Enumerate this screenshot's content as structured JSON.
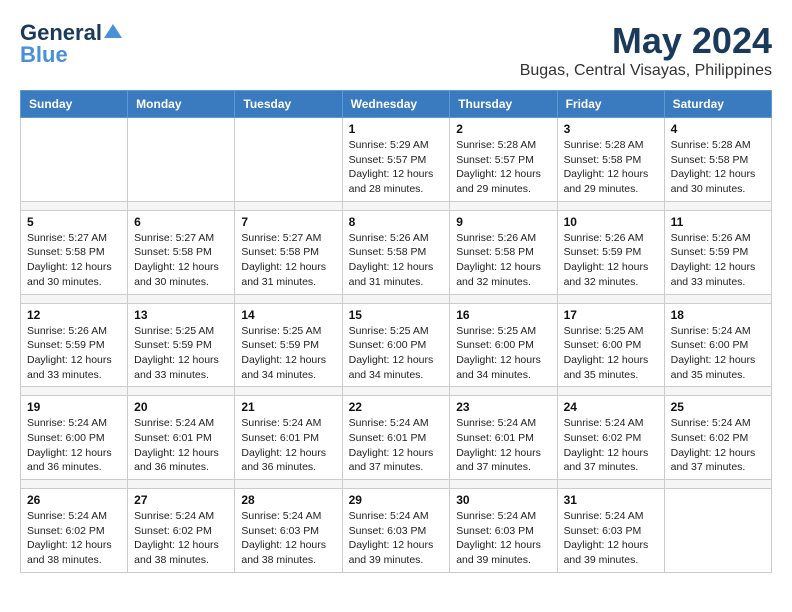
{
  "header": {
    "logo_line1": "General",
    "logo_line2": "Blue",
    "month_year": "May 2024",
    "location": "Bugas, Central Visayas, Philippines"
  },
  "weekdays": [
    "Sunday",
    "Monday",
    "Tuesday",
    "Wednesday",
    "Thursday",
    "Friday",
    "Saturday"
  ],
  "weeks": [
    [
      {
        "day": "",
        "info": ""
      },
      {
        "day": "",
        "info": ""
      },
      {
        "day": "",
        "info": ""
      },
      {
        "day": "1",
        "info": "Sunrise: 5:29 AM\nSunset: 5:57 PM\nDaylight: 12 hours\nand 28 minutes."
      },
      {
        "day": "2",
        "info": "Sunrise: 5:28 AM\nSunset: 5:57 PM\nDaylight: 12 hours\nand 29 minutes."
      },
      {
        "day": "3",
        "info": "Sunrise: 5:28 AM\nSunset: 5:58 PM\nDaylight: 12 hours\nand 29 minutes."
      },
      {
        "day": "4",
        "info": "Sunrise: 5:28 AM\nSunset: 5:58 PM\nDaylight: 12 hours\nand 30 minutes."
      }
    ],
    [
      {
        "day": "5",
        "info": "Sunrise: 5:27 AM\nSunset: 5:58 PM\nDaylight: 12 hours\nand 30 minutes."
      },
      {
        "day": "6",
        "info": "Sunrise: 5:27 AM\nSunset: 5:58 PM\nDaylight: 12 hours\nand 30 minutes."
      },
      {
        "day": "7",
        "info": "Sunrise: 5:27 AM\nSunset: 5:58 PM\nDaylight: 12 hours\nand 31 minutes."
      },
      {
        "day": "8",
        "info": "Sunrise: 5:26 AM\nSunset: 5:58 PM\nDaylight: 12 hours\nand 31 minutes."
      },
      {
        "day": "9",
        "info": "Sunrise: 5:26 AM\nSunset: 5:58 PM\nDaylight: 12 hours\nand 32 minutes."
      },
      {
        "day": "10",
        "info": "Sunrise: 5:26 AM\nSunset: 5:59 PM\nDaylight: 12 hours\nand 32 minutes."
      },
      {
        "day": "11",
        "info": "Sunrise: 5:26 AM\nSunset: 5:59 PM\nDaylight: 12 hours\nand 33 minutes."
      }
    ],
    [
      {
        "day": "12",
        "info": "Sunrise: 5:26 AM\nSunset: 5:59 PM\nDaylight: 12 hours\nand 33 minutes."
      },
      {
        "day": "13",
        "info": "Sunrise: 5:25 AM\nSunset: 5:59 PM\nDaylight: 12 hours\nand 33 minutes."
      },
      {
        "day": "14",
        "info": "Sunrise: 5:25 AM\nSunset: 5:59 PM\nDaylight: 12 hours\nand 34 minutes."
      },
      {
        "day": "15",
        "info": "Sunrise: 5:25 AM\nSunset: 6:00 PM\nDaylight: 12 hours\nand 34 minutes."
      },
      {
        "day": "16",
        "info": "Sunrise: 5:25 AM\nSunset: 6:00 PM\nDaylight: 12 hours\nand 34 minutes."
      },
      {
        "day": "17",
        "info": "Sunrise: 5:25 AM\nSunset: 6:00 PM\nDaylight: 12 hours\nand 35 minutes."
      },
      {
        "day": "18",
        "info": "Sunrise: 5:24 AM\nSunset: 6:00 PM\nDaylight: 12 hours\nand 35 minutes."
      }
    ],
    [
      {
        "day": "19",
        "info": "Sunrise: 5:24 AM\nSunset: 6:00 PM\nDaylight: 12 hours\nand 36 minutes."
      },
      {
        "day": "20",
        "info": "Sunrise: 5:24 AM\nSunset: 6:01 PM\nDaylight: 12 hours\nand 36 minutes."
      },
      {
        "day": "21",
        "info": "Sunrise: 5:24 AM\nSunset: 6:01 PM\nDaylight: 12 hours\nand 36 minutes."
      },
      {
        "day": "22",
        "info": "Sunrise: 5:24 AM\nSunset: 6:01 PM\nDaylight: 12 hours\nand 37 minutes."
      },
      {
        "day": "23",
        "info": "Sunrise: 5:24 AM\nSunset: 6:01 PM\nDaylight: 12 hours\nand 37 minutes."
      },
      {
        "day": "24",
        "info": "Sunrise: 5:24 AM\nSunset: 6:02 PM\nDaylight: 12 hours\nand 37 minutes."
      },
      {
        "day": "25",
        "info": "Sunrise: 5:24 AM\nSunset: 6:02 PM\nDaylight: 12 hours\nand 37 minutes."
      }
    ],
    [
      {
        "day": "26",
        "info": "Sunrise: 5:24 AM\nSunset: 6:02 PM\nDaylight: 12 hours\nand 38 minutes."
      },
      {
        "day": "27",
        "info": "Sunrise: 5:24 AM\nSunset: 6:02 PM\nDaylight: 12 hours\nand 38 minutes."
      },
      {
        "day": "28",
        "info": "Sunrise: 5:24 AM\nSunset: 6:03 PM\nDaylight: 12 hours\nand 38 minutes."
      },
      {
        "day": "29",
        "info": "Sunrise: 5:24 AM\nSunset: 6:03 PM\nDaylight: 12 hours\nand 39 minutes."
      },
      {
        "day": "30",
        "info": "Sunrise: 5:24 AM\nSunset: 6:03 PM\nDaylight: 12 hours\nand 39 minutes."
      },
      {
        "day": "31",
        "info": "Sunrise: 5:24 AM\nSunset: 6:03 PM\nDaylight: 12 hours\nand 39 minutes."
      },
      {
        "day": "",
        "info": ""
      }
    ]
  ]
}
